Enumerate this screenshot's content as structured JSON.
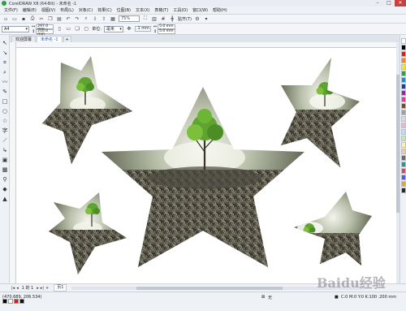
{
  "window": {
    "title": "CorelDRAW X8 (64-Bit) - 未命名 -1"
  },
  "menu": [
    "文件(F)",
    "编辑(E)",
    "视图(V)",
    "布局(L)",
    "对象(C)",
    "效果(C)",
    "位图(B)",
    "文本(X)",
    "表格(T)",
    "工具(O)",
    "窗口(W)",
    "帮助(H)"
  ],
  "toolbar": {
    "zoom": "75%",
    "snap_label": "贴齐(T)"
  },
  "properties": {
    "page_size": "A4",
    "width": "297.0 mm",
    "height": "210.0 mm",
    "units_label": "单位:",
    "units": "毫米",
    "nudge": ".1 mm",
    "dup_x": "5.0 mm",
    "dup_y": "5.0 mm"
  },
  "tabs": [
    {
      "label": "欢迎屏幕"
    },
    {
      "label": "未命名 -1"
    }
  ],
  "pagebar": {
    "page_info": "1 的 1",
    "page_tab": "页1"
  },
  "status": {
    "coords": "(470.689, 206.534)",
    "fill_status": "无",
    "outline_status": "C:0 M:0 Y:0 K:100 .200 mm"
  },
  "watermark": "Baidu经验",
  "palette_colors": [
    "#ffffff",
    "#000000",
    "#e21a1a",
    "#f08a1c",
    "#f6e71b",
    "#29a53a",
    "#1b8fd1",
    "#1e3f9a",
    "#8c2d91",
    "#e43f8f",
    "#7a4a22",
    "#a0a0a0",
    "#d9d9d9",
    "#f7b4c8",
    "#b6e0f5",
    "#c7e6a8",
    "#fff2a8",
    "#f2c9a0",
    "#6b6b6b",
    "#3a8f87",
    "#d24d57",
    "#5b5bd6",
    "#e6a23c",
    "#2a2a2a"
  ],
  "icons": [
    "pick-icon",
    "shape-icon",
    "crop-icon",
    "zoom-icon",
    "freehand-icon",
    "artistic-media-icon",
    "rectangle-icon",
    "ellipse-icon",
    "polygon-icon",
    "text-icon",
    "parallel-dimension-icon",
    "connector-icon",
    "drop-shadow-icon",
    "transparency-icon",
    "eyedropper-icon",
    "interactive-fill-icon",
    "smart-fill-icon"
  ]
}
